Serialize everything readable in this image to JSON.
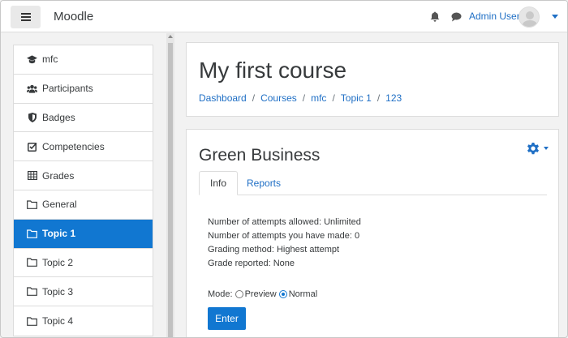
{
  "navbar": {
    "brand": "Moodle",
    "user_name": "Admin User",
    "icons": [
      "hamburger-icon",
      "bell-icon",
      "chat-icon",
      "avatar",
      "caret-down-icon"
    ]
  },
  "sidebar": {
    "items": [
      {
        "label": "mfc",
        "icon": "graduation-cap-icon",
        "active": false
      },
      {
        "label": "Participants",
        "icon": "users-icon",
        "active": false
      },
      {
        "label": "Badges",
        "icon": "shield-icon",
        "active": false
      },
      {
        "label": "Competencies",
        "icon": "checkbox-icon",
        "active": false
      },
      {
        "label": "Grades",
        "icon": "table-icon",
        "active": false
      },
      {
        "label": "General",
        "icon": "folder-icon",
        "active": false
      },
      {
        "label": "Topic 1",
        "icon": "folder-icon",
        "active": true
      },
      {
        "label": "Topic 2",
        "icon": "folder-icon",
        "active": false
      },
      {
        "label": "Topic 3",
        "icon": "folder-icon",
        "active": false
      },
      {
        "label": "Topic 4",
        "icon": "folder-icon",
        "active": false
      }
    ]
  },
  "header": {
    "course_title": "My first course",
    "breadcrumb": [
      "Dashboard",
      "Courses",
      "mfc",
      "Topic 1",
      "123"
    ],
    "separator": "/"
  },
  "activity": {
    "title": "Green Business",
    "tabs": [
      {
        "label": "Info",
        "active": true
      },
      {
        "label": "Reports",
        "active": false
      }
    ],
    "info_lines": [
      "Number of attempts allowed: Unlimited",
      "Number of attempts you have made: 0",
      "Grading method: Highest attempt",
      "Grade reported: None"
    ],
    "mode_label": "Mode:",
    "mode_options": [
      {
        "label": "Preview",
        "checked": false
      },
      {
        "label": "Normal",
        "checked": true
      }
    ],
    "enter_label": "Enter"
  },
  "colors": {
    "accent": "#1177d1",
    "link": "#1f6fc5",
    "background": "#f2f2f2"
  }
}
